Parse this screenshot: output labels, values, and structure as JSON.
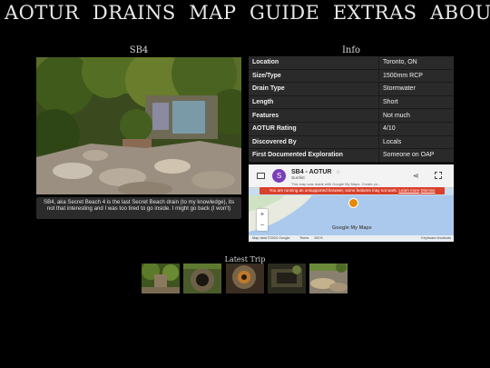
{
  "nav": {
    "items": [
      "AOTUR",
      "DRAINS",
      "MAP",
      "GUIDE",
      "EXTRAS",
      "ABOUT"
    ]
  },
  "photo": {
    "title": "SB4",
    "caption": "SB4, aka Secret Beach 4 is the last Secret Beach drain (to my knowledge), its not that interesting and I was too tired to go inside. I might go back (I won't)"
  },
  "info": {
    "title": "Info",
    "rows": [
      {
        "label": "Location",
        "value": "Toronto, ON"
      },
      {
        "label": "Size/Type",
        "value": "1500mm RCP"
      },
      {
        "label": "Drain Type",
        "value": "Stormwater"
      },
      {
        "label": "Length",
        "value": "Short"
      },
      {
        "label": "Features",
        "value": "Not much"
      },
      {
        "label": "AOTUR Rating",
        "value": "4/10"
      },
      {
        "label": "Discovered By",
        "value": "Locals"
      },
      {
        "label": "First Documented Exploration",
        "value": "Someone on OAP"
      }
    ]
  },
  "map": {
    "title": "SB4 - AOTUR",
    "subtitle": "Sunfist",
    "avatar_letter": "S",
    "notice": "This map was made with Google My Maps. Create yo...",
    "warning": "You are running an unsupported browser, some features may not work.",
    "warning_link": "Learn more",
    "dismiss": "Dismiss",
    "zoom_in": "+",
    "zoom_out": "−",
    "google_label": "Google My Maps",
    "attribution": "Map data ©2024 Google",
    "terms": "Terms",
    "scale": "100 ft",
    "shortcuts": "Keyboard shortcuts"
  },
  "trip": {
    "title": "Latest Trip"
  }
}
